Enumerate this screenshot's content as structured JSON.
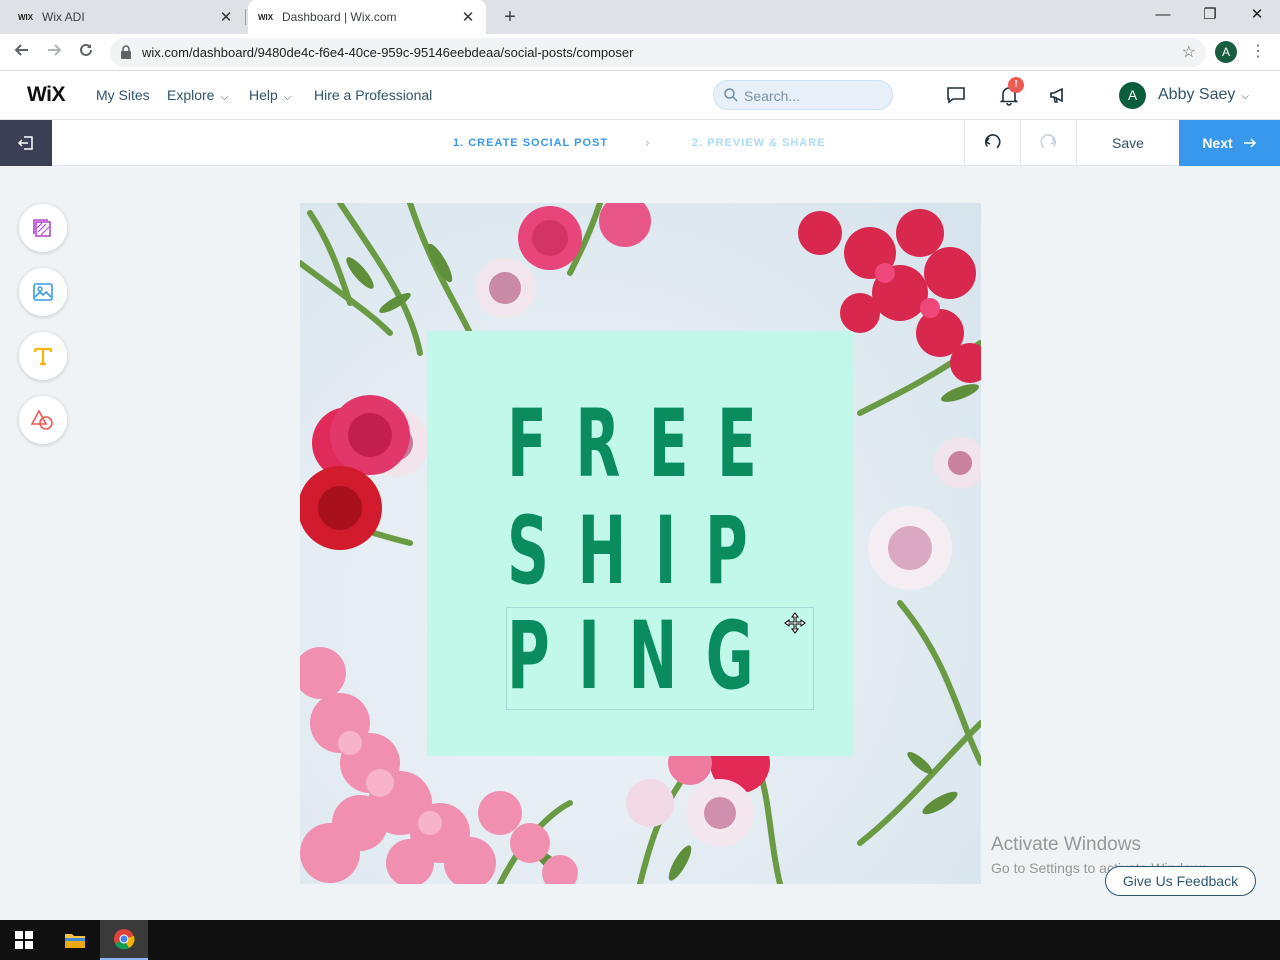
{
  "browser": {
    "tabs": [
      {
        "favicon": "WIX",
        "title": "Wix ADI",
        "close": "✕"
      },
      {
        "favicon": "WIX",
        "title": "Dashboard | Wix.com",
        "close": "✕"
      }
    ],
    "new_tab": "+",
    "window_controls": {
      "minimize": "—",
      "maximize": "❐",
      "close": "✕"
    },
    "url": "wix.com/dashboard/9480de4c-f6e4-40ce-959c-95146eebdeaa/social-posts/composer",
    "profile_initial": "A",
    "icons": [
      "back-arrow-icon",
      "forward-arrow-icon",
      "reload-icon",
      "lock-icon",
      "bookmark-star-icon",
      "kebab-menu-icon"
    ]
  },
  "wix_header": {
    "logo": "WiX",
    "nav": {
      "my_sites": "My Sites",
      "explore": "Explore",
      "help": "Help",
      "hire": "Hire a Professional"
    },
    "search_placeholder": "Search...",
    "notification_badge": "!",
    "user_initial": "A",
    "user_name": "Abby Saey",
    "icons": [
      "chat-icon",
      "bell-icon",
      "megaphone-icon",
      "chevron-down-icon"
    ]
  },
  "editor_bar": {
    "step1": "1. CREATE SOCIAL POST",
    "step_separator": "›",
    "step2": "2. PREVIEW & SHARE",
    "save": "Save",
    "next": "Next",
    "icons": [
      "exit-icon",
      "undo-icon",
      "redo-icon",
      "arrow-right-icon"
    ]
  },
  "tools": [
    "layouts-icon",
    "image-icon",
    "text-icon",
    "shapes-icon"
  ],
  "canvas": {
    "text_lines": [
      "FREE",
      "SHIP",
      "PING"
    ],
    "text_color": "#0a8c5f",
    "box_color": "#c1f8e9"
  },
  "overlay": {
    "activate_title": "Activate Windows",
    "activate_sub": "Go to Settings to activate Windows.",
    "feedback": "Give Us Feedback"
  },
  "colors": {
    "accent": "#3899ec",
    "exit_bg": "#3b4057",
    "avatar": "#0b5e3c"
  }
}
